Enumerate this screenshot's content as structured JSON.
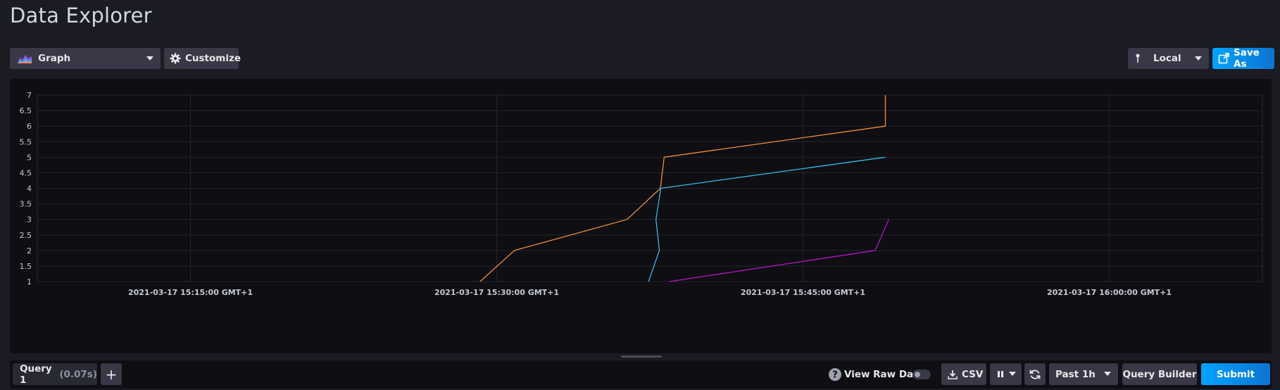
{
  "page": {
    "title": "Data Explorer"
  },
  "toolbar": {
    "view_type": "Graph",
    "customize_label": "Customize",
    "timezone": "Local",
    "save_as_label": "Save As"
  },
  "chart_data": {
    "type": "line",
    "y_ticks": [
      "1",
      "1.5",
      "2",
      "2.5",
      "3",
      "3.5",
      "4",
      "4.5",
      "5",
      "5.5",
      "6",
      "6.5",
      "7"
    ],
    "ylim": [
      1,
      7
    ],
    "x_tick_labels": [
      "2021-03-17 15:15:00 GMT+1",
      "2021-03-17 15:30:00 GMT+1",
      "2021-03-17 15:45:00 GMT+1",
      "2021-03-17 16:00:00 GMT+1"
    ],
    "x_tick_times": [
      "15:15:00",
      "15:30:00",
      "15:45:00",
      "16:00:00"
    ],
    "xlim": [
      "15:07:30",
      "16:07:30"
    ],
    "grid": true,
    "series": [
      {
        "color": "#f48d38",
        "points": [
          [
            "15:29:11",
            1
          ],
          [
            "15:30:52",
            2
          ],
          [
            "15:36:23",
            3
          ],
          [
            "15:38:01",
            4
          ],
          [
            "15:38:12",
            5
          ],
          [
            "15:49:02",
            6
          ],
          [
            "15:49:02",
            7
          ]
        ]
      },
      {
        "color": "#34bbe8",
        "points": [
          [
            "15:37:26",
            1
          ],
          [
            "15:37:58",
            2
          ],
          [
            "15:37:48",
            3
          ],
          [
            "15:38:02",
            4
          ],
          [
            "15:49:02",
            5
          ]
        ]
      },
      {
        "color": "#b615c5",
        "points": [
          [
            "15:38:27",
            1
          ],
          [
            "15:48:32",
            2
          ],
          [
            "15:49:12",
            3
          ]
        ]
      }
    ]
  },
  "query": {
    "tab_label": "Query 1",
    "tab_time": "(0.07s)",
    "add_label": "+"
  },
  "controls": {
    "view_raw_label": "View Raw Data",
    "csv_label": "CSV",
    "time_range": "Past 1h",
    "query_builder_label": "Query Builder",
    "submit_label": "Submit"
  }
}
